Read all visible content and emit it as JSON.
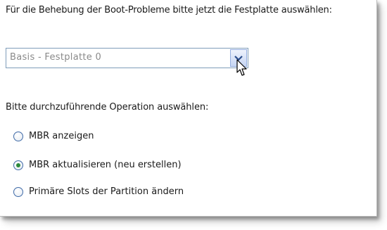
{
  "intro_text": "Für die Behebung der Boot-Probleme bitte jetzt die Festplatte auswählen:",
  "disk_select": {
    "value": "Basis -  Festplatte 0"
  },
  "operation_label": "Bitte durchzuführende Operation auswählen:",
  "operations": [
    {
      "label": "MBR anzeigen",
      "checked": false
    },
    {
      "label": "MBR aktualisieren (neu erstellen)",
      "checked": true
    },
    {
      "label": "Primäre Slots der Partition ändern",
      "checked": false
    }
  ],
  "colors": {
    "radio_checked": "#2c8a3c",
    "select_border": "#7f9db9"
  }
}
